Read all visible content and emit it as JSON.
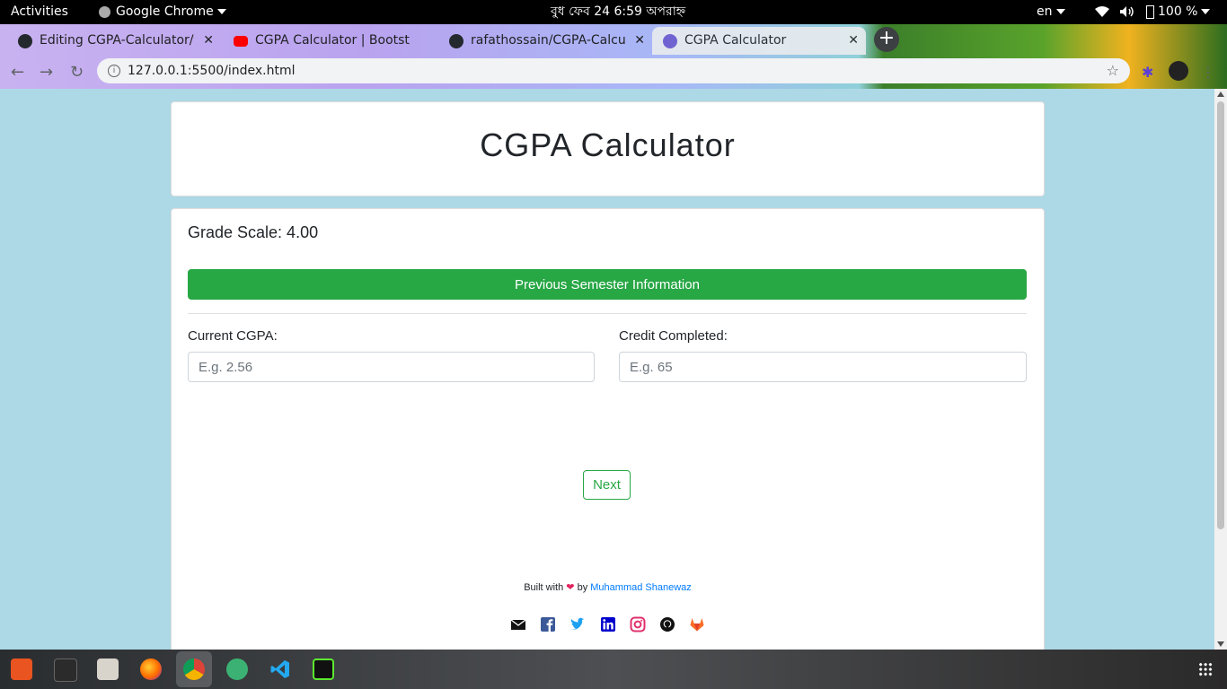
{
  "topbar": {
    "activities": "Activities",
    "app_name": "Google Chrome",
    "clock": "বুধ ফেব 24   6:59 অপরাহ্ন",
    "language": "en",
    "battery": "100 %"
  },
  "browser": {
    "tabs": [
      {
        "label": "Editing CGPA-Calculator/f",
        "icon": "github-icon"
      },
      {
        "label": "CGPA Calculator | Bootstr",
        "icon": "youtube-icon"
      },
      {
        "label": "rafathossain/CGPA-Calcul",
        "icon": "github-icon"
      },
      {
        "label": "CGPA Calculator",
        "icon": "globe-icon",
        "active": true
      }
    ],
    "url": "127.0.0.1:5500/index.html"
  },
  "page": {
    "title": "CGPA Calculator",
    "grade_scale": "Grade Scale: 4.00",
    "prev_semester_button": "Previous Semester Information",
    "current_cgpa_label": "Current CGPA:",
    "current_cgpa_placeholder": "E.g. 2.56",
    "current_cgpa_value": "",
    "credit_label": "Credit Completed:",
    "credit_placeholder": "E.g. 65",
    "credit_value": "",
    "next_button": "Next",
    "footer": {
      "built_with": "Built with",
      "by": "by",
      "author": "Muhammad Shanewaz"
    },
    "socials": [
      "mail-icon",
      "facebook-icon",
      "twitter-icon",
      "linkedin-icon",
      "instagram-icon",
      "github-icon",
      "gitlab-icon"
    ]
  },
  "colors": {
    "page_bg": "#add8e6",
    "success": "#28a745",
    "link": "#007bff"
  }
}
